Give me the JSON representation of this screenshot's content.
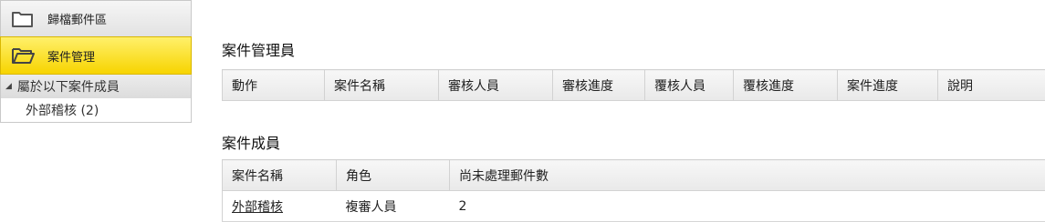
{
  "nav": {
    "archive_label": "歸檔郵件區",
    "case_mgmt_label": "案件管理",
    "subheader_label": "屬於以下案件成員",
    "sub_item_label": "外部稽核 (2)"
  },
  "case_admins": {
    "title": "案件管理員",
    "columns": [
      "動作",
      "案件名稱",
      "審核人員",
      "審核進度",
      "覆核人員",
      "覆核進度",
      "案件進度",
      "說明"
    ]
  },
  "case_members": {
    "title": "案件成員",
    "columns": [
      "案件名稱",
      "角色",
      "尚未處理郵件數"
    ],
    "rows": [
      {
        "case_name": "外部稽核",
        "role": "複審人員",
        "pending": "2"
      }
    ]
  },
  "colors": {
    "active_nav": "#f7d400",
    "header_bg": "#ececec"
  }
}
